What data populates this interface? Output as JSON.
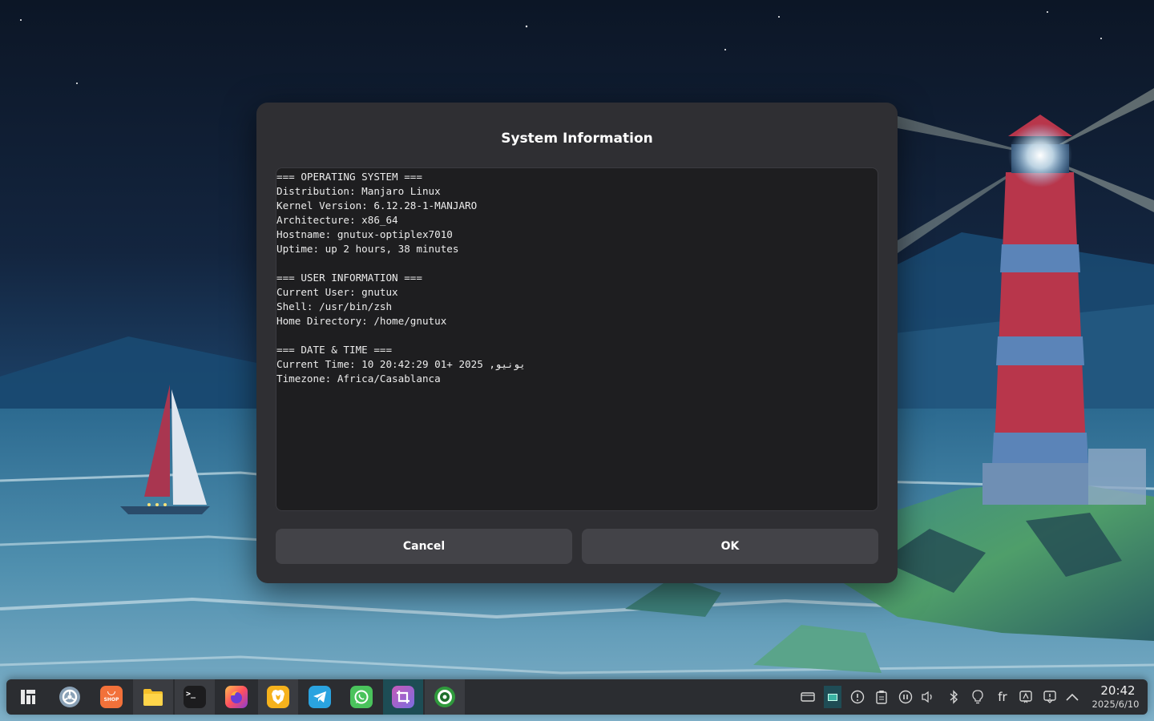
{
  "dialog": {
    "title": "System Information",
    "lines": [
      "=== OPERATING SYSTEM ===",
      "Distribution: Manjaro Linux",
      "Kernel Version: 6.12.28-1-MANJARO",
      "Architecture: x86_64",
      "Hostname: gnutux-optiplex7010",
      "Uptime: up 2 hours, 38 minutes",
      "",
      "=== USER INFORMATION ===",
      "Current User: gnutux",
      "Shell: /usr/bin/zsh",
      "Home Directory: /home/gnutux",
      "",
      "=== DATE & TIME ===",
      "Current Time: 10 20:42:29 01+ 2025 ,يونيو",
      "Timezone: Africa/Casablanca"
    ],
    "cancel_label": "Cancel",
    "ok_label": "OK"
  },
  "taskbar": {
    "apps": [
      {
        "name": "launcher-icon"
      },
      {
        "name": "system-settings-icon"
      },
      {
        "name": "software-store-icon",
        "label": "SHOP"
      },
      {
        "name": "file-manager-icon"
      },
      {
        "name": "terminal-icon",
        "label": ">_"
      },
      {
        "name": "firefox-icon"
      },
      {
        "name": "brave-icon"
      },
      {
        "name": "telegram-icon"
      },
      {
        "name": "whatsapp-icon"
      },
      {
        "name": "screenshot-crop-icon"
      },
      {
        "name": "system-info-app-icon"
      }
    ],
    "tray": {
      "language": "fr",
      "time": "20:42",
      "date": "2025/6/10"
    }
  },
  "colors": {
    "dialog_bg": "#2f2f33",
    "textarea_bg": "#1e1e20",
    "button_bg": "#434348",
    "taskbar_bg": "#2b2d31"
  }
}
